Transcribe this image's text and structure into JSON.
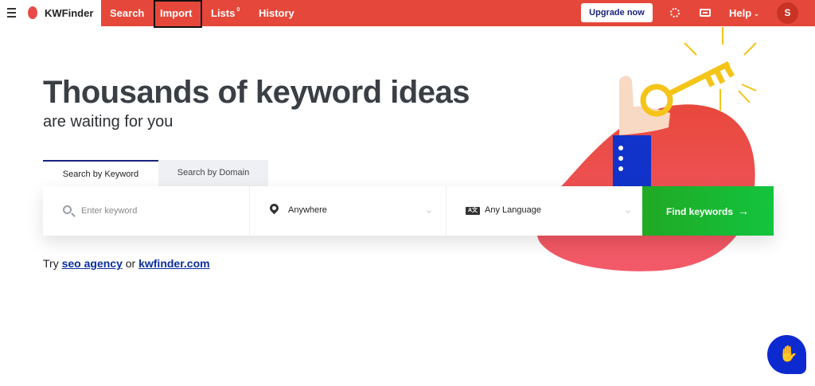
{
  "brand": {
    "name": "KWFinder"
  },
  "nav": {
    "items": [
      {
        "label": "Search"
      },
      {
        "label": "Import"
      },
      {
        "label": "Lists",
        "badge": "0"
      },
      {
        "label": "History"
      }
    ]
  },
  "header": {
    "upgrade_label": "Upgrade now",
    "help_label": "Help",
    "avatar_initial": "S"
  },
  "hero": {
    "title": "Thousands of keyword ideas",
    "subtitle": "are waiting for you"
  },
  "tabs": [
    {
      "label": "Search by Keyword",
      "active": true
    },
    {
      "label": "Search by Domain",
      "active": false
    }
  ],
  "search": {
    "keyword_placeholder": "Enter keyword",
    "location": "Anywhere",
    "language": "Any Language",
    "language_icon": "A文",
    "submit_label": "Find keywords"
  },
  "try": {
    "prefix": "Try",
    "link1": "seo agency",
    "middle": "or",
    "link2": "kwfinder.com"
  },
  "colors": {
    "topbar": "#e5483a",
    "accent_navy": "#1a237e",
    "button_green": "#1bb62f",
    "link": "#0a2ea0",
    "chat": "#0d2ad1"
  }
}
